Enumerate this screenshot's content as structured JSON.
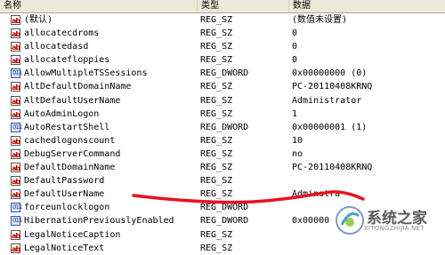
{
  "header": {
    "name": "名称",
    "type": "类型",
    "data": "数据"
  },
  "rows": [
    {
      "icon": "string-value-icon",
      "name": "(默认)",
      "type": "REG_SZ",
      "data": "(数值未设置)"
    },
    {
      "icon": "string-value-icon",
      "name": "allocatecdroms",
      "type": "REG_SZ",
      "data": "0"
    },
    {
      "icon": "string-value-icon",
      "name": "allocatedasd",
      "type": "REG_SZ",
      "data": "0"
    },
    {
      "icon": "string-value-icon",
      "name": "allocatefloppies",
      "type": "REG_SZ",
      "data": "0"
    },
    {
      "icon": "dword-value-icon",
      "name": "AllowMultipleTSSessions",
      "type": "REG_DWORD",
      "data": "0x00000000 (0)"
    },
    {
      "icon": "string-value-icon",
      "name": "AltDefaultDomainName",
      "type": "REG_SZ",
      "data": "PC-20110408KRNQ"
    },
    {
      "icon": "string-value-icon",
      "name": "AltDefaultUserName",
      "type": "REG_SZ",
      "data": "Administrator"
    },
    {
      "icon": "string-value-icon",
      "name": "AutoAdminLogon",
      "type": "REG_SZ",
      "data": "1"
    },
    {
      "icon": "dword-value-icon",
      "name": "AutoRestartShell",
      "type": "REG_DWORD",
      "data": "0x00000001 (1)"
    },
    {
      "icon": "string-value-icon",
      "name": "cachedlogonscount",
      "type": "REG_SZ",
      "data": "10"
    },
    {
      "icon": "string-value-icon",
      "name": "DebugServerCommand",
      "type": "REG_SZ",
      "data": "no"
    },
    {
      "icon": "string-value-icon",
      "name": "DefaultDomainName",
      "type": "REG_SZ",
      "data": "PC-20110408KRNQ"
    },
    {
      "icon": "string-value-icon",
      "name": "DefaultPassword",
      "type": "REG_SZ",
      "data": ""
    },
    {
      "icon": "string-value-icon",
      "name": "DefaultUserName",
      "type": "REG_SZ",
      "data": "Adminstra"
    },
    {
      "icon": "dword-value-icon",
      "name": "forceunlocklogon",
      "type": "REG_DWORD",
      "data": ""
    },
    {
      "icon": "dword-value-icon",
      "name": "HibernationPreviouslyEnabled",
      "type": "REG_DWORD",
      "data": "0x00000"
    },
    {
      "icon": "string-value-icon",
      "name": "LegalNoticeCaption",
      "type": "REG_SZ",
      "data": ""
    },
    {
      "icon": "string-value-icon",
      "name": "LegalNoticeText",
      "type": "REG_SZ",
      "data": ""
    }
  ],
  "annotation": {
    "color": "#e8141e"
  },
  "watermark": {
    "title": "系统之家",
    "url": "XITONGZHIJIA.NET"
  }
}
